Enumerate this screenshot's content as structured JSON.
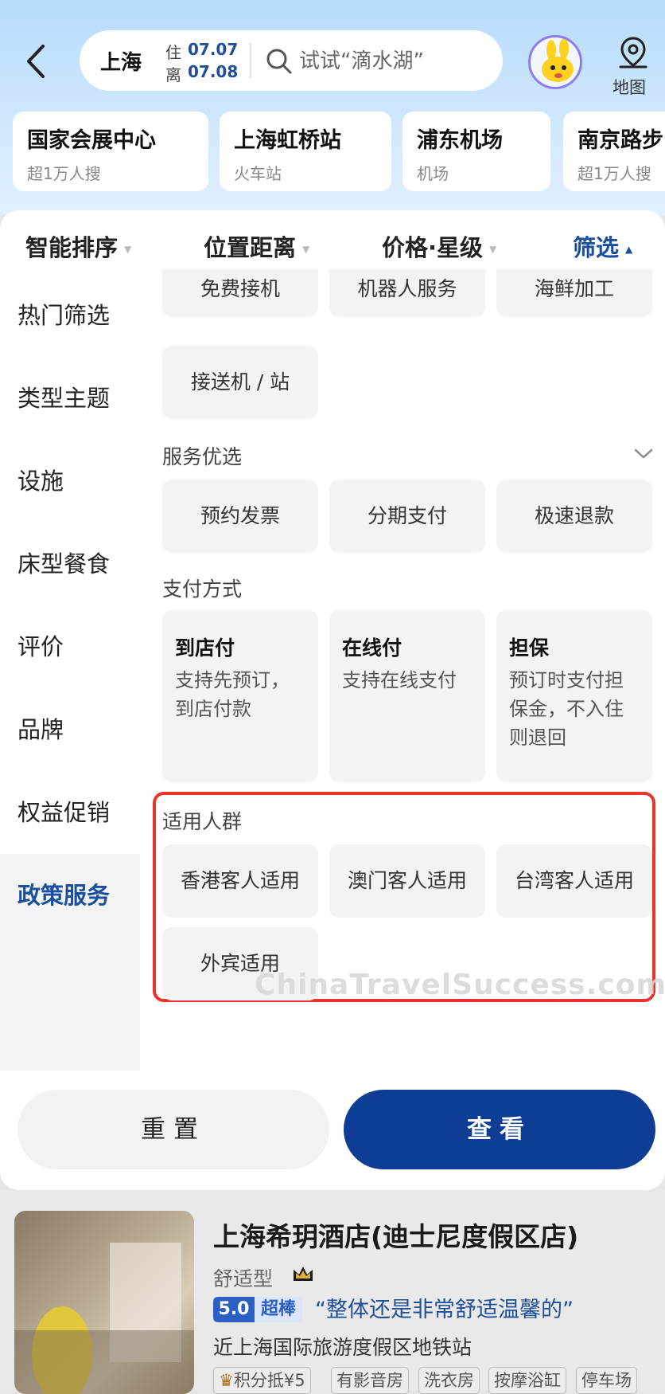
{
  "header": {
    "city": "上海",
    "checkin_label": "住",
    "checkin_date": "07.07",
    "checkout_label": "离",
    "checkout_date": "07.08",
    "search_placeholder": "试试“滴水湖”",
    "map_label": "地图"
  },
  "quick_chips": [
    {
      "title": "国家会展中心",
      "sub": "超1万人搜"
    },
    {
      "title": "上海虹桥站",
      "sub": "火车站"
    },
    {
      "title": "浦东机场",
      "sub": "机场"
    },
    {
      "title": "南京路步",
      "sub": "超1万人搜"
    }
  ],
  "sort_tabs": [
    "智能排序",
    "位置距离",
    "价格·星级",
    "筛选"
  ],
  "sidebar": [
    "热门筛选",
    "类型主题",
    "设施",
    "床型餐食",
    "评价",
    "品牌",
    "权益促销",
    "政策服务"
  ],
  "options": {
    "top_row": [
      "免费接机",
      "机器人服务",
      "海鲜加工"
    ],
    "pickup": "接送机 / 站",
    "service_title": "服务优选",
    "service": [
      "预约发票",
      "分期支付",
      "极速退款"
    ],
    "payment_title": "支付方式",
    "payment": [
      {
        "title": "到店付",
        "desc": "支持先预订，到店付款"
      },
      {
        "title": "在线付",
        "desc": "支持在线支付"
      },
      {
        "title": "担保",
        "desc": "预订时支付担保金，不入住则退回"
      }
    ],
    "audience_title": "适用人群",
    "audience": [
      "香港客人适用",
      "澳门客人适用",
      "台湾客人适用",
      "外宾适用"
    ]
  },
  "watermark": "ChinaTravelSuccess.com",
  "buttons": {
    "reset": "重置",
    "view": "查看"
  },
  "hotel": {
    "name": "上海希玥酒店(迪士尼度假区店)",
    "type": "舒适型",
    "score": "5.0",
    "score_word": "超棒",
    "review": "“整体还是非常舒适温馨的”",
    "location": "近上海国际旅游度假区地铁站",
    "tags": [
      "积分抵¥5",
      "有影音房",
      "洗衣房",
      "按摩浴缸",
      "停车场"
    ]
  },
  "colors": {
    "accent": "#1a4fa0",
    "view_button": "#0d3d94",
    "highlight": "#e8342b"
  }
}
